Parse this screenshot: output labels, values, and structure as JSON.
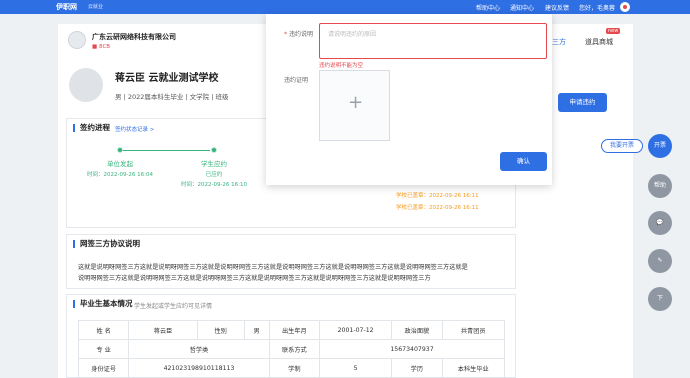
{
  "topbar": {
    "logo": "伊职网",
    "logo_sub": "云就业",
    "nav": [
      "帮助中心",
      "通知中心",
      "建议反馈",
      "您好，毛奥蓉"
    ]
  },
  "company": {
    "name": "广东云研网络科技有限公司",
    "code": "8CB",
    "tab_active": "三方",
    "tab_shop": "道具商城",
    "new_badge": "new"
  },
  "student": {
    "name": "蒋云臣  云就业测试学校",
    "info": "男 | 2022届本科生毕业 | 文学院 | 班级",
    "apply_button": "申请违约"
  },
  "progress": {
    "title": "签约进程",
    "record_link": "签约状态记录 >",
    "steps": [
      {
        "title": "单位发起",
        "status": "",
        "time": "时间：2022-09-26 16:04"
      },
      {
        "title": "学生应约",
        "status": "已应约",
        "time": "时间：2022-09-26 16:10"
      }
    ],
    "extra_times": [
      "学校已盖章：2022-09-26 16:11",
      "学校已盖章：2022-09-26 16:11"
    ]
  },
  "agreement": {
    "title": "网签三方协议说明",
    "lines": [
      "这就是说明呀网签三方这就是说明呀网签三方这就是说明呀网签三方这就是说明呀网签三方这就是说明呀网签三方这就是说明呀网签三方这就是",
      "说明呀网签三方这就是说明呀网签三方这就是说明呀网签三方这就是说明呀网签三方这就是说明呀网签三方这就是说明呀网签三方"
    ]
  },
  "basic": {
    "title": "毕业生基本情况",
    "subtitle": "学生发起或学生应约可见详情",
    "rows": [
      [
        "姓  名",
        "蒋云臣",
        "性别",
        "男",
        "出生年月",
        "2001-07-12",
        "政治面貌",
        "共青团员"
      ],
      [
        "专  业",
        "哲学类",
        "",
        "",
        "联系方式",
        "15673407937",
        "",
        ""
      ],
      [
        "身份证号",
        "421023198910118113",
        "",
        "",
        "学制",
        "5",
        "学历",
        "本科生毕业"
      ]
    ]
  },
  "floating": {
    "wokaipiao": "我要开票",
    "fabs": [
      "开票",
      "帮助",
      "",
      "",
      "下"
    ]
  },
  "modal": {
    "reason_label": "违约说明",
    "required_mark": "*",
    "reason_placeholder": "请说明违约的原因",
    "reason_error": "违约说明不能为空",
    "proof_label": "违约证明",
    "upload_plus": "+",
    "confirm_button": "确认"
  }
}
